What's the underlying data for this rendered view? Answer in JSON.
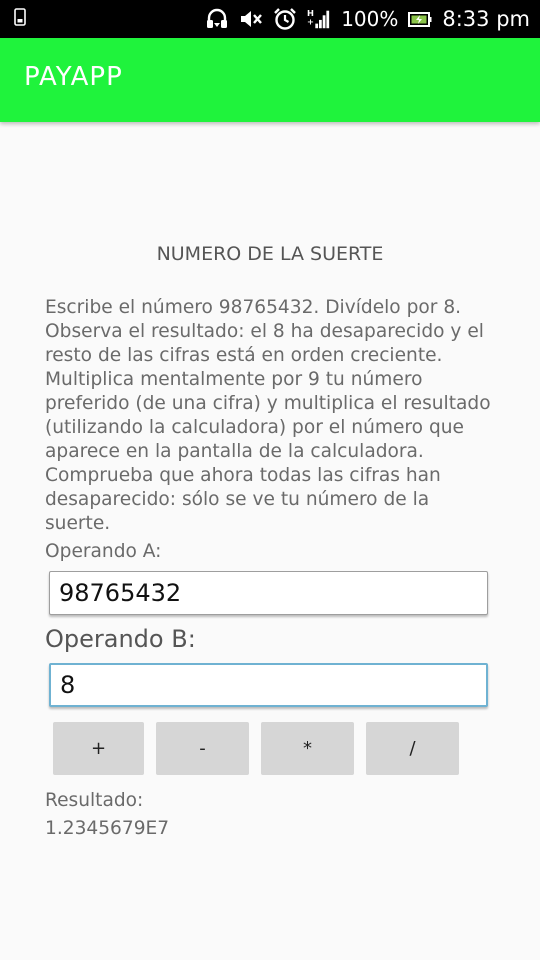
{
  "status_bar": {
    "icons": [
      "sim-icon",
      "headset-icon",
      "mute-icon",
      "alarm-icon",
      "hplus-signal-icon",
      "battery-icon"
    ],
    "battery": "100%",
    "time": "8:33 pm"
  },
  "app_bar": {
    "title": "PAYAPP"
  },
  "main": {
    "section_title": "NUMERO DE LA SUERTE",
    "instructions": "Escribe el número 98765432. Divídelo por 8. Observa el resultado: el 8 ha desaparecido y el resto de las cifras está en orden creciente. Multiplica mentalmente por 9 tu número preferido (de una cifra) y multiplica el resultado (utilizando la calculadora) por el número que aparece en la pantalla de la calculadora. Comprueba que ahora todas las cifras han desaparecido: sólo se ve tu número de la suerte.",
    "operand_a": {
      "label": "Operando A:",
      "value": "98765432"
    },
    "operand_b": {
      "label": "Operando B:",
      "value": "8"
    },
    "operations": {
      "add": "+",
      "subtract": "-",
      "multiply": "*",
      "divide": "/"
    },
    "result": {
      "label": "Resultado:",
      "value": "1.2345679E7"
    }
  },
  "colors": {
    "app_bar": "#1ff33c",
    "status_bar": "#000000",
    "focus_border": "#6fb2d2"
  }
}
